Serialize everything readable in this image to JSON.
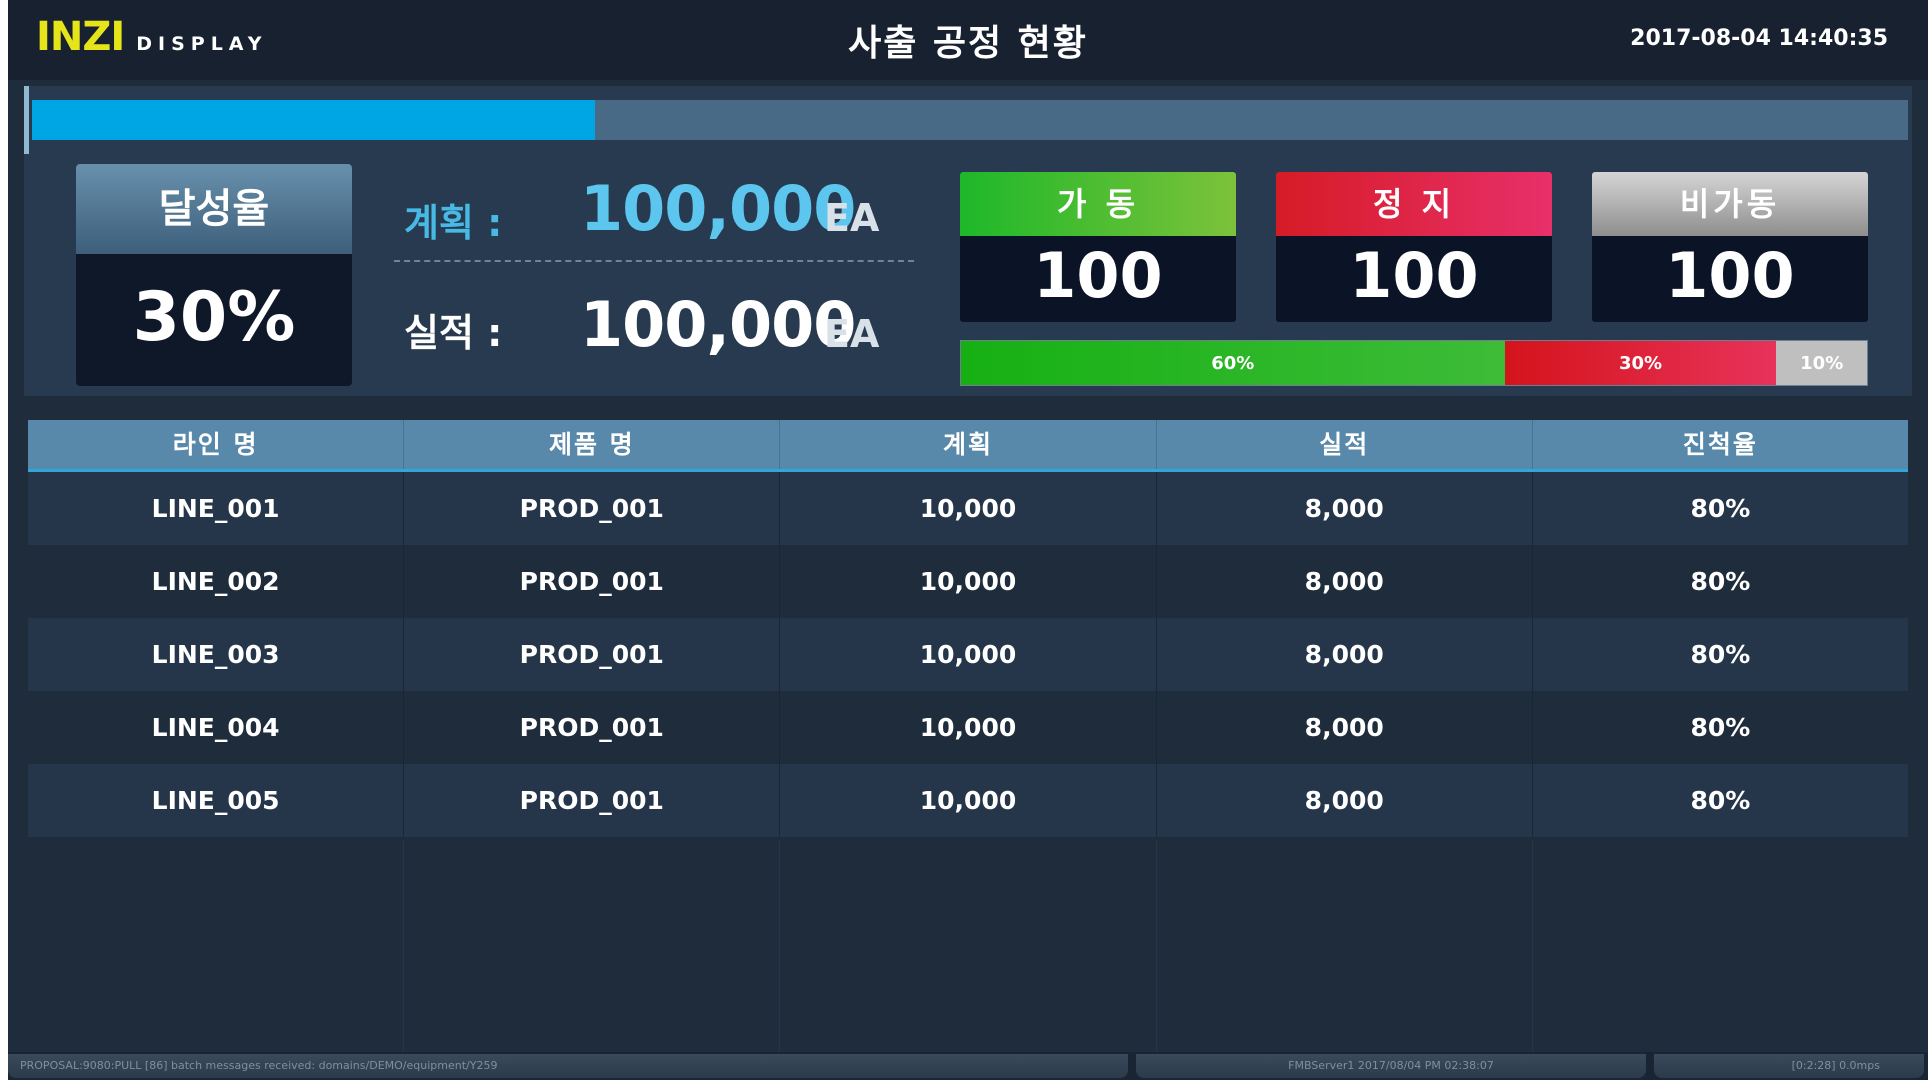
{
  "header": {
    "logo_main": "INZI",
    "logo_sub": "DISPLAY",
    "title": "사출 공정 현황",
    "datetime": "2017-08-04 14:40:35"
  },
  "progress": {
    "percent": 30
  },
  "summary": {
    "rate_label": "달성율",
    "rate_value": "30%",
    "plan_label": "계획 :",
    "plan_value": "100,000",
    "plan_unit": "EA",
    "actual_label": "실적 :",
    "actual_value": "100,000",
    "actual_unit": "EA"
  },
  "status": {
    "running": {
      "label": "가 동",
      "value": "100"
    },
    "stopped": {
      "label": "정 지",
      "value": "100"
    },
    "idle": {
      "label": "비가동",
      "value": "100"
    }
  },
  "distribution": {
    "running": {
      "percent": 60,
      "label": "60%"
    },
    "stopped": {
      "percent": 30,
      "label": "30%"
    },
    "idle": {
      "percent": 10,
      "label": "10%"
    }
  },
  "table": {
    "headers": [
      "라인 명",
      "제품 명",
      "계획",
      "실적",
      "진척율"
    ],
    "rows": [
      [
        "LINE_001",
        "PROD_001",
        "10,000",
        "8,000",
        "80%"
      ],
      [
        "LINE_002",
        "PROD_001",
        "10,000",
        "8,000",
        "80%"
      ],
      [
        "LINE_003",
        "PROD_001",
        "10,000",
        "8,000",
        "80%"
      ],
      [
        "LINE_004",
        "PROD_001",
        "10,000",
        "8,000",
        "80%"
      ],
      [
        "LINE_005",
        "PROD_001",
        "10,000",
        "8,000",
        "80%"
      ]
    ]
  },
  "statusbar": {
    "message": "PROPOSAL:9080:PULL [86] batch messages received: domains/DEMO/equipment/Y259",
    "server": "FMBServer1 2017/08/04 PM 02:38:07",
    "rate": "[0:2:28] 0.0mps"
  }
}
